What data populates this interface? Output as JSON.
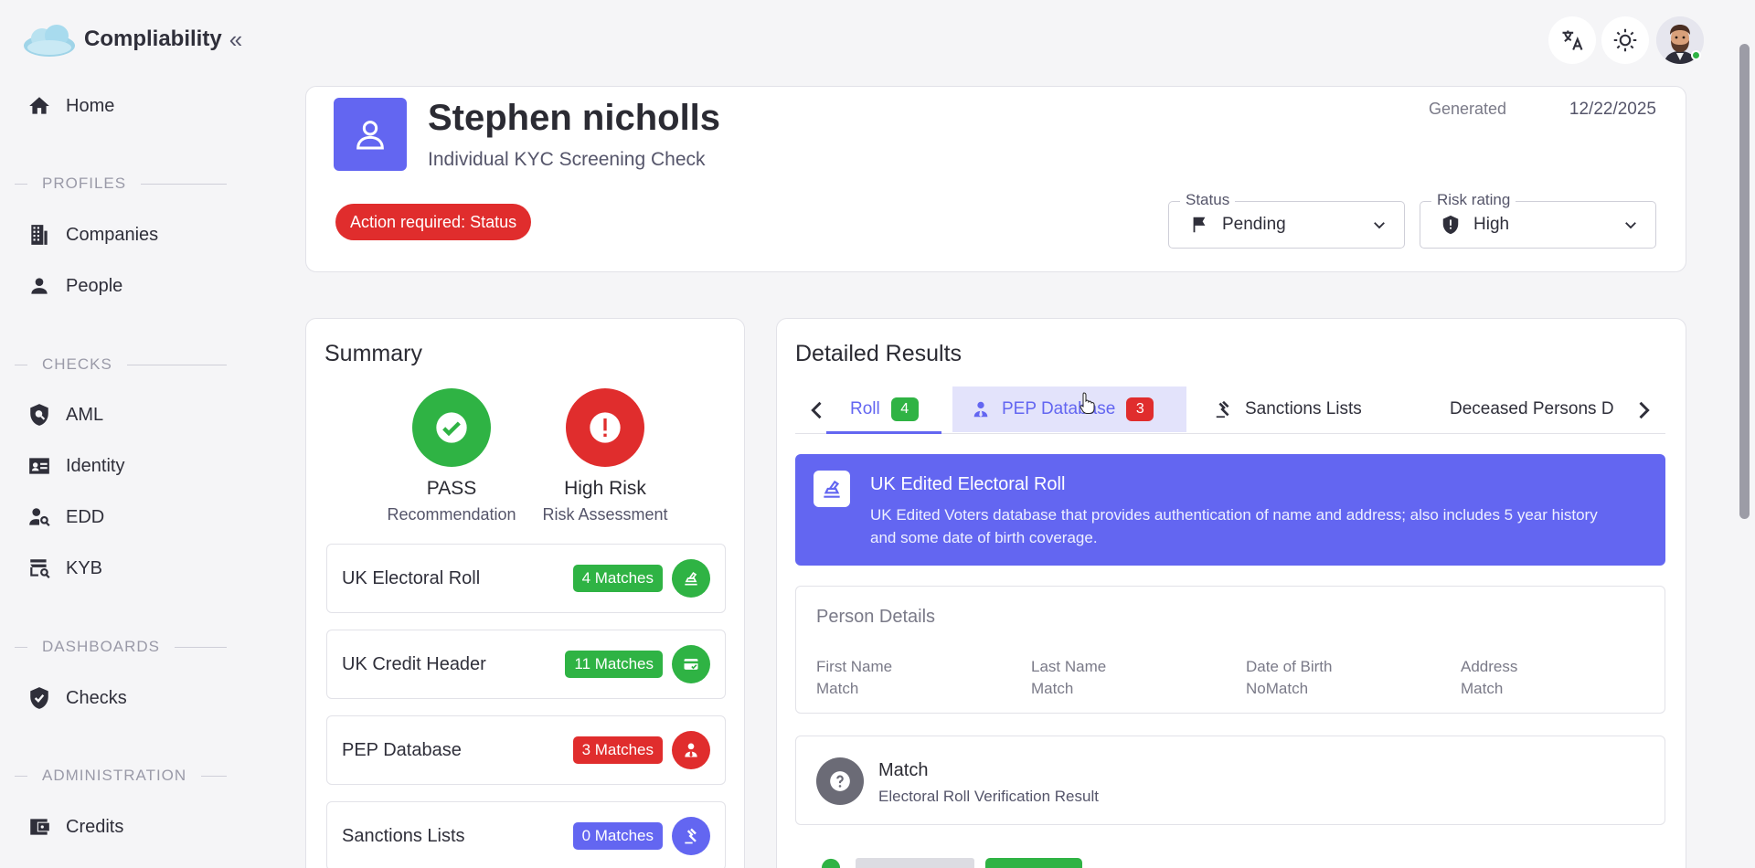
{
  "app": {
    "name": "Compliability"
  },
  "sidebar": {
    "items": [
      {
        "label": "Home",
        "icon": "home-icon"
      },
      {
        "section": "PROFILES"
      },
      {
        "label": "Companies",
        "icon": "building-icon"
      },
      {
        "label": "People",
        "icon": "person-icon"
      },
      {
        "section": "CHECKS"
      },
      {
        "label": "AML",
        "icon": "shield-search-icon"
      },
      {
        "label": "Identity",
        "icon": "id-card-icon"
      },
      {
        "label": "EDD",
        "icon": "person-search-icon"
      },
      {
        "label": "KYB",
        "icon": "store-search-icon"
      },
      {
        "section": "DASHBOARDS"
      },
      {
        "label": "Checks",
        "icon": "shield-check-icon"
      },
      {
        "section": "ADMINISTRATION"
      },
      {
        "label": "Credits",
        "icon": "wallet-icon"
      }
    ]
  },
  "header": {
    "name": "Stephen nicholls",
    "subtitle": "Individual KYC Screening Check",
    "generated_label": "Generated",
    "generated_date": "12/22/2025",
    "action_pill": "Action required: Status",
    "status": {
      "label": "Status",
      "value": "Pending"
    },
    "risk": {
      "label": "Risk rating",
      "value": "High"
    }
  },
  "summary": {
    "title": "Summary",
    "recommendation": {
      "value": "PASS",
      "label": "Recommendation"
    },
    "risk_assessment": {
      "value": "High Risk",
      "label": "Risk Assessment"
    },
    "rows": [
      {
        "label": "UK Electoral Roll",
        "badge": "4 Matches",
        "color": "#2fb344"
      },
      {
        "label": "UK Credit Header",
        "badge": "11 Matches",
        "color": "#2fb344"
      },
      {
        "label": "PEP Database",
        "badge": "3 Matches",
        "color": "#e02d2d"
      },
      {
        "label": "Sanctions Lists",
        "badge": "0 Matches",
        "color": "#6366f1"
      }
    ]
  },
  "details": {
    "title": "Detailed Results",
    "tabs": [
      {
        "label": "Roll",
        "badge": "4",
        "badge_color": "#2fb344",
        "active": true
      },
      {
        "label": "PEP Database",
        "badge": "3",
        "badge_color": "#e02d2d",
        "hovered": true
      },
      {
        "label": "Sanctions Lists"
      },
      {
        "label": "Deceased Persons D"
      }
    ],
    "banner": {
      "title": "UK Edited Electoral Roll",
      "description": "UK Edited Voters database that provides authentication of name and address; also includes 5 year history and some date of birth coverage."
    },
    "person_details": {
      "title": "Person Details",
      "fields": [
        {
          "key": "First Name",
          "value": "Match"
        },
        {
          "key": "Last Name",
          "value": "Match"
        },
        {
          "key": "Date of Birth",
          "value": "NoMatch"
        },
        {
          "key": "Address",
          "value": "Match"
        }
      ]
    },
    "match_result": {
      "title": "Match",
      "subtitle": "Electoral Roll Verification Result"
    }
  },
  "colors": {
    "accent": "#6366f1",
    "success": "#2fb344",
    "danger": "#e02d2d"
  }
}
